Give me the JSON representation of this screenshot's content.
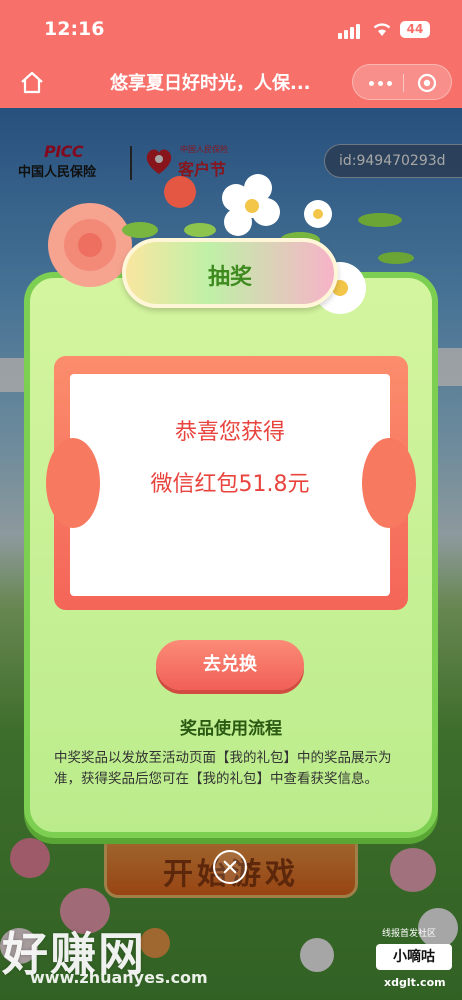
{
  "status_bar": {
    "time": "12:16",
    "battery": "44"
  },
  "nav": {
    "title": "悠享夏日好时光，人保..."
  },
  "brand": {
    "picc_mark": "PICC",
    "picc_name": "中国人民保险",
    "fest_small": "中国人民保险",
    "fest_name": "客户节"
  },
  "user": {
    "id": "id:949470293d"
  },
  "modal": {
    "ribbon": "抽奖",
    "congrats": "恭喜您获得",
    "prize": "微信红包51.8元",
    "redeem_button": "去兑换",
    "flow_title": "奖品使用流程",
    "flow_text": "中奖奖品以发放至活动页面【我的礼包】中的奖品展示为准，获得奖品后您可在【我的礼包】中查看获奖信息。"
  },
  "background": {
    "start_button": "开始游戏"
  },
  "watermark": {
    "site_cn": "好赚网",
    "site_url": "www.zhuanyes.com",
    "tag_top": "线报首发社区",
    "tag_badge": "小嘀咕",
    "tag_url": "xdglt.com"
  },
  "colors": {
    "nav": "#f7706a",
    "modal": "#bbec8c",
    "prize": "#e8443d",
    "button": "#f15f57"
  },
  "icons": [
    "home-icon",
    "more-dots-icon",
    "target-icon",
    "close-icon"
  ]
}
